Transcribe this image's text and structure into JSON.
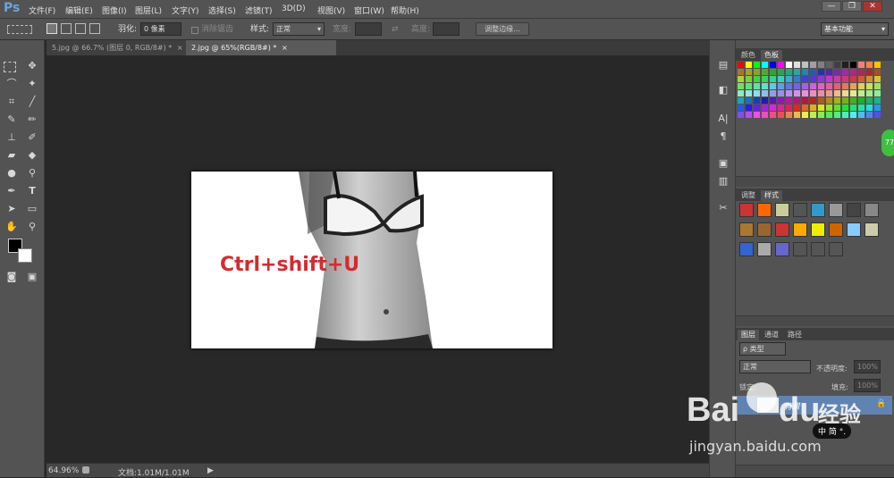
{
  "app": {
    "logo": "Ps"
  },
  "menubar": {
    "items": [
      {
        "label": "文件(F)"
      },
      {
        "label": "编辑(E)"
      },
      {
        "label": "图像(I)"
      },
      {
        "label": "图层(L)"
      },
      {
        "label": "文字(Y)"
      },
      {
        "label": "选择(S)"
      },
      {
        "label": "滤镜(T)"
      },
      {
        "label": "3D(D)"
      },
      {
        "label": "视图(V)"
      },
      {
        "label": "窗口(W)"
      },
      {
        "label": "帮助(H)"
      }
    ],
    "window_buttons": [
      "—",
      "❐",
      "✕"
    ]
  },
  "options": {
    "feather_label": "羽化:",
    "feather_value": "0 像素",
    "antialias_label": "消除锯齿",
    "style_label": "样式:",
    "style_value": "正常",
    "width_label": "宽度:",
    "height_label": "高度:",
    "refine_button": "调整边缘...",
    "workspace": "基本功能"
  },
  "tabs": [
    {
      "label": "5.jpg @ 66.7% (图层 0, RGB/8#) *",
      "close": "×",
      "active": false
    },
    {
      "label": "2.jpg @ 65%(RGB/8#) *",
      "close": "×",
      "active": true
    }
  ],
  "canvas": {
    "overlay_text": "Ctrl+shift+U"
  },
  "status": {
    "zoom": "64.96%",
    "doc": "文档:1.01M/1.01M",
    "arrow": "▶"
  },
  "panels": {
    "swatch_tabs": [
      "颜色",
      "色板"
    ],
    "style_tabs": [
      "调整",
      "样式"
    ],
    "layer_tabs": [
      "图层",
      "通道",
      "路径"
    ],
    "layers_kind": "ρ 类型",
    "blend_mode": "正常",
    "opacity_label": "不透明度:",
    "opacity_value": "100%",
    "lock_label": "锁定:",
    "fill_label": "填充:",
    "fill_value": "100%",
    "layer_name": "背景",
    "badge": "77"
  },
  "watermark": {
    "brand": "Bai",
    "paw": "du",
    "cn": "经验",
    "url": "jingyan.baidu.com",
    "ime": "中 简 °."
  },
  "colors": {
    "accent": "#6ea4d8",
    "overlay_text": "#d42b30",
    "layer_selected": "#6183b2",
    "badge": "#3fbf3f"
  }
}
